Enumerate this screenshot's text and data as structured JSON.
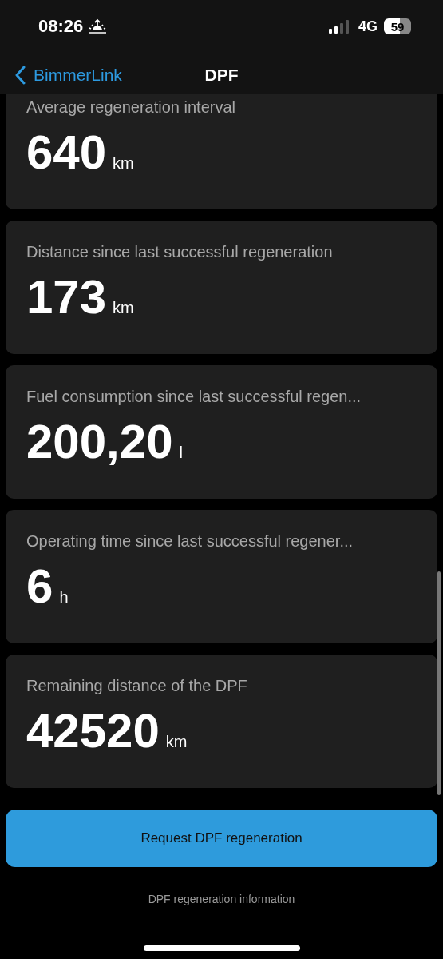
{
  "status_bar": {
    "time": "08:26",
    "network": "4G",
    "battery": "59"
  },
  "nav": {
    "back_label": "BimmerLink",
    "title": "DPF"
  },
  "cards": [
    {
      "label": "Average regeneration interval",
      "value": "640",
      "unit": "km"
    },
    {
      "label": "Distance since last successful regeneration",
      "value": "173",
      "unit": "km"
    },
    {
      "label": "Fuel consumption since last successful regen...",
      "value": "200,20",
      "unit": "l"
    },
    {
      "label": "Operating time since last successful regener...",
      "value": "6",
      "unit": "h"
    },
    {
      "label": "Remaining distance of the DPF",
      "value": "42520",
      "unit": "km"
    }
  ],
  "action_button": "Request DPF regeneration",
  "info_link": "DPF regeneration information"
}
